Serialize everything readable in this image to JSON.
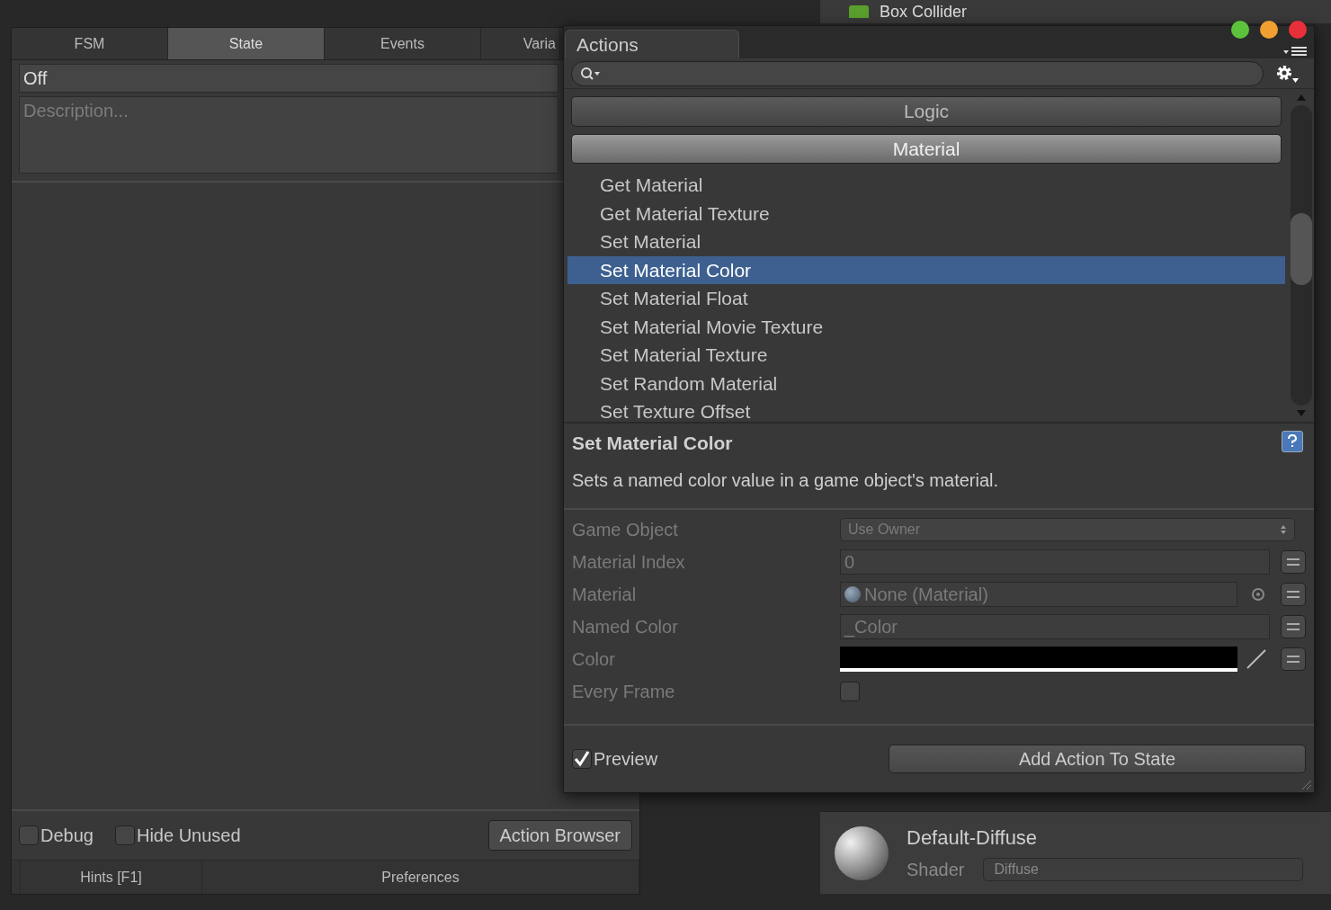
{
  "inspector": {
    "component_title": "Box Collider",
    "material": {
      "name": "Default-Diffuse",
      "shader_label": "Shader",
      "shader": "Diffuse"
    }
  },
  "fsm_panel": {
    "tabs": [
      {
        "label": "FSM",
        "selected": false
      },
      {
        "label": "State",
        "selected": true
      },
      {
        "label": "Events",
        "selected": false
      },
      {
        "label": "Varia",
        "selected": false
      }
    ],
    "state_name": "Off",
    "description_placeholder": "Description...",
    "options": [
      {
        "label": "Debug",
        "checked": false
      },
      {
        "label": "Hide Unused",
        "checked": false
      }
    ],
    "action_browser_button": "Action Browser",
    "bottom_tabs": [
      {
        "label": "Hints [F1]"
      },
      {
        "label": "Preferences"
      }
    ]
  },
  "actions_window": {
    "title": "Actions",
    "list": [
      {
        "kind": "category",
        "label": "Logic",
        "expanded": false
      },
      {
        "kind": "category",
        "label": "Material",
        "expanded": true
      },
      {
        "kind": "action",
        "label": "Get Material",
        "selected": false
      },
      {
        "kind": "action",
        "label": "Get Material Texture",
        "selected": false
      },
      {
        "kind": "action",
        "label": "Set Material",
        "selected": false
      },
      {
        "kind": "action",
        "label": "Set Material Color",
        "selected": true
      },
      {
        "kind": "action",
        "label": "Set Material Float",
        "selected": false
      },
      {
        "kind": "action",
        "label": "Set Material Movie Texture",
        "selected": false
      },
      {
        "kind": "action",
        "label": "Set Material Texture",
        "selected": false
      },
      {
        "kind": "action",
        "label": "Set Random Material",
        "selected": false
      },
      {
        "kind": "action",
        "label": "Set Texture Offset",
        "selected": false
      }
    ],
    "details": {
      "title": "Set Material Color",
      "description": "Sets a named color value in a game object's material."
    },
    "params": [
      {
        "kind": "dropdown",
        "label": "Game Object",
        "value": "Use Owner"
      },
      {
        "kind": "text",
        "label": "Material Index",
        "value": "0"
      },
      {
        "kind": "object",
        "label": "Material",
        "value": "None (Material)"
      },
      {
        "kind": "text",
        "label": "Named Color",
        "value": "_Color"
      },
      {
        "kind": "color",
        "label": "Color"
      },
      {
        "kind": "checkbox",
        "label": "Every Frame",
        "checked": false
      }
    ],
    "preview": {
      "label": "Preview",
      "checked": true
    },
    "add_button": "Add Action To State"
  }
}
